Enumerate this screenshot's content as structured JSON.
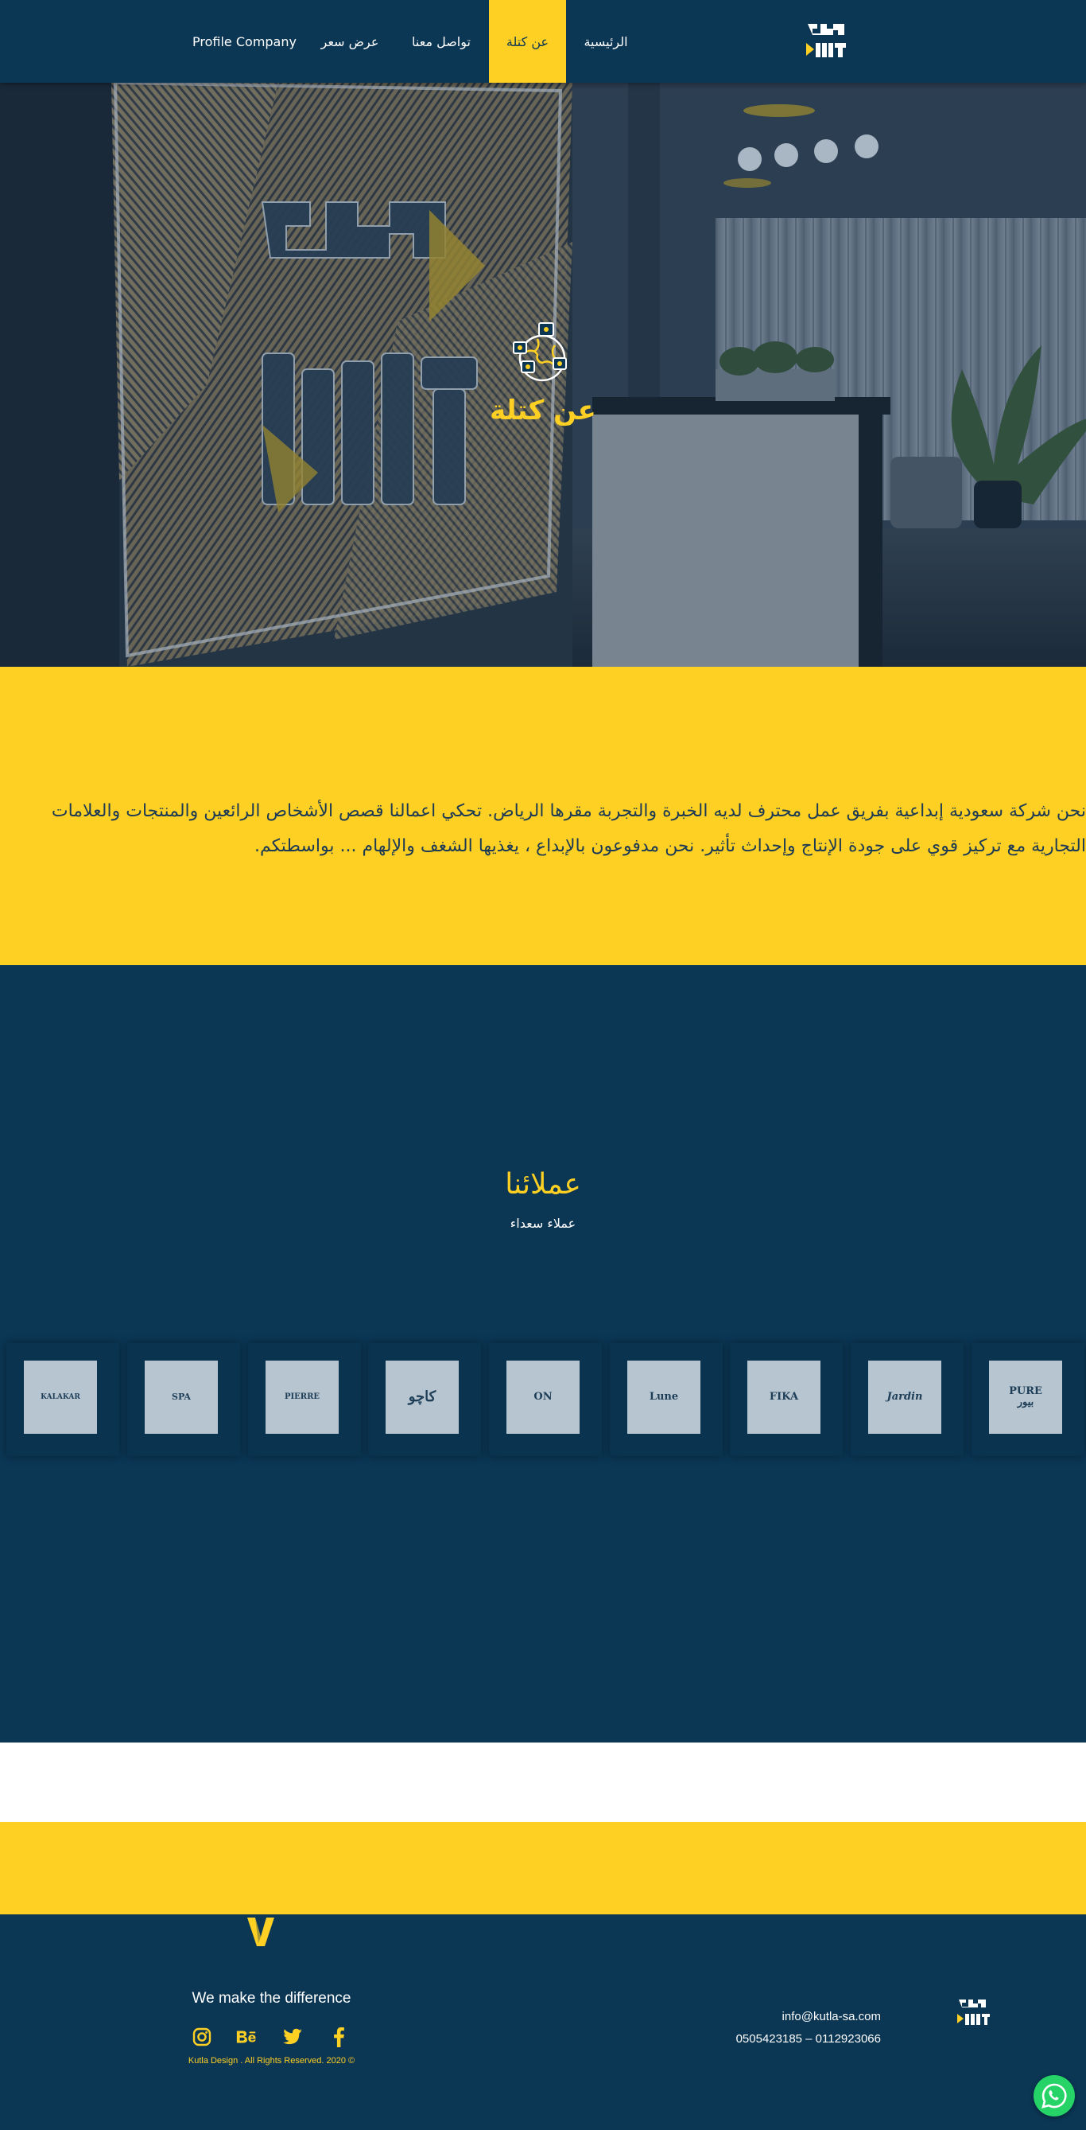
{
  "header": {
    "logo_text": "كتلة KUTLA",
    "nav": [
      {
        "label": "الرئيسية",
        "active": false
      },
      {
        "label": "عن كتلة",
        "active": true
      },
      {
        "label": "تواصل معنا",
        "active": false
      },
      {
        "label": "عرض سعر",
        "active": false
      },
      {
        "label": "Profile Company",
        "active": false
      }
    ]
  },
  "hero": {
    "title": "عن كتلة",
    "icon": "globe-network-icon"
  },
  "about": {
    "text": "نحن شركة سعودية إبداعية بفريق عمل محترف لديه الخبرة والتجربة مقرها الرياض. تحكي اعمالنا قصص الأشخاص الرائعين والمنتجات والعلامات التجارية مع تركيز قوي على جودة الإنتاج وإحداث تأثير. نحن مدفوعون بالإبداع ، يغذيها الشغف والإلهام ... بواسطتكم."
  },
  "clients": {
    "title": "عملائنا",
    "subtitle": "عملاء سعداء",
    "logos": [
      {
        "text": "PURE\nبيور"
      },
      {
        "text": "Jardin"
      },
      {
        "text": "FIKA"
      },
      {
        "text": "Lune"
      },
      {
        "text": "ON"
      },
      {
        "text": "كاچو"
      },
      {
        "text": "PIERRE"
      },
      {
        "text": "SPA"
      },
      {
        "text": "KALAKAR"
      }
    ]
  },
  "footer": {
    "tagline": "We make the difference",
    "copyright": "Kutla Design . All Rights Reserved. 2020 ©",
    "email": "info@kutla-sa.com",
    "phone": "0505423185 – 0112923066",
    "socials": [
      "instagram-icon",
      "behance-icon",
      "twitter-icon",
      "facebook-icon"
    ]
  },
  "colors": {
    "navy": "#0b3654",
    "yellow": "#fdd023",
    "whatsapp": "#25d366"
  }
}
